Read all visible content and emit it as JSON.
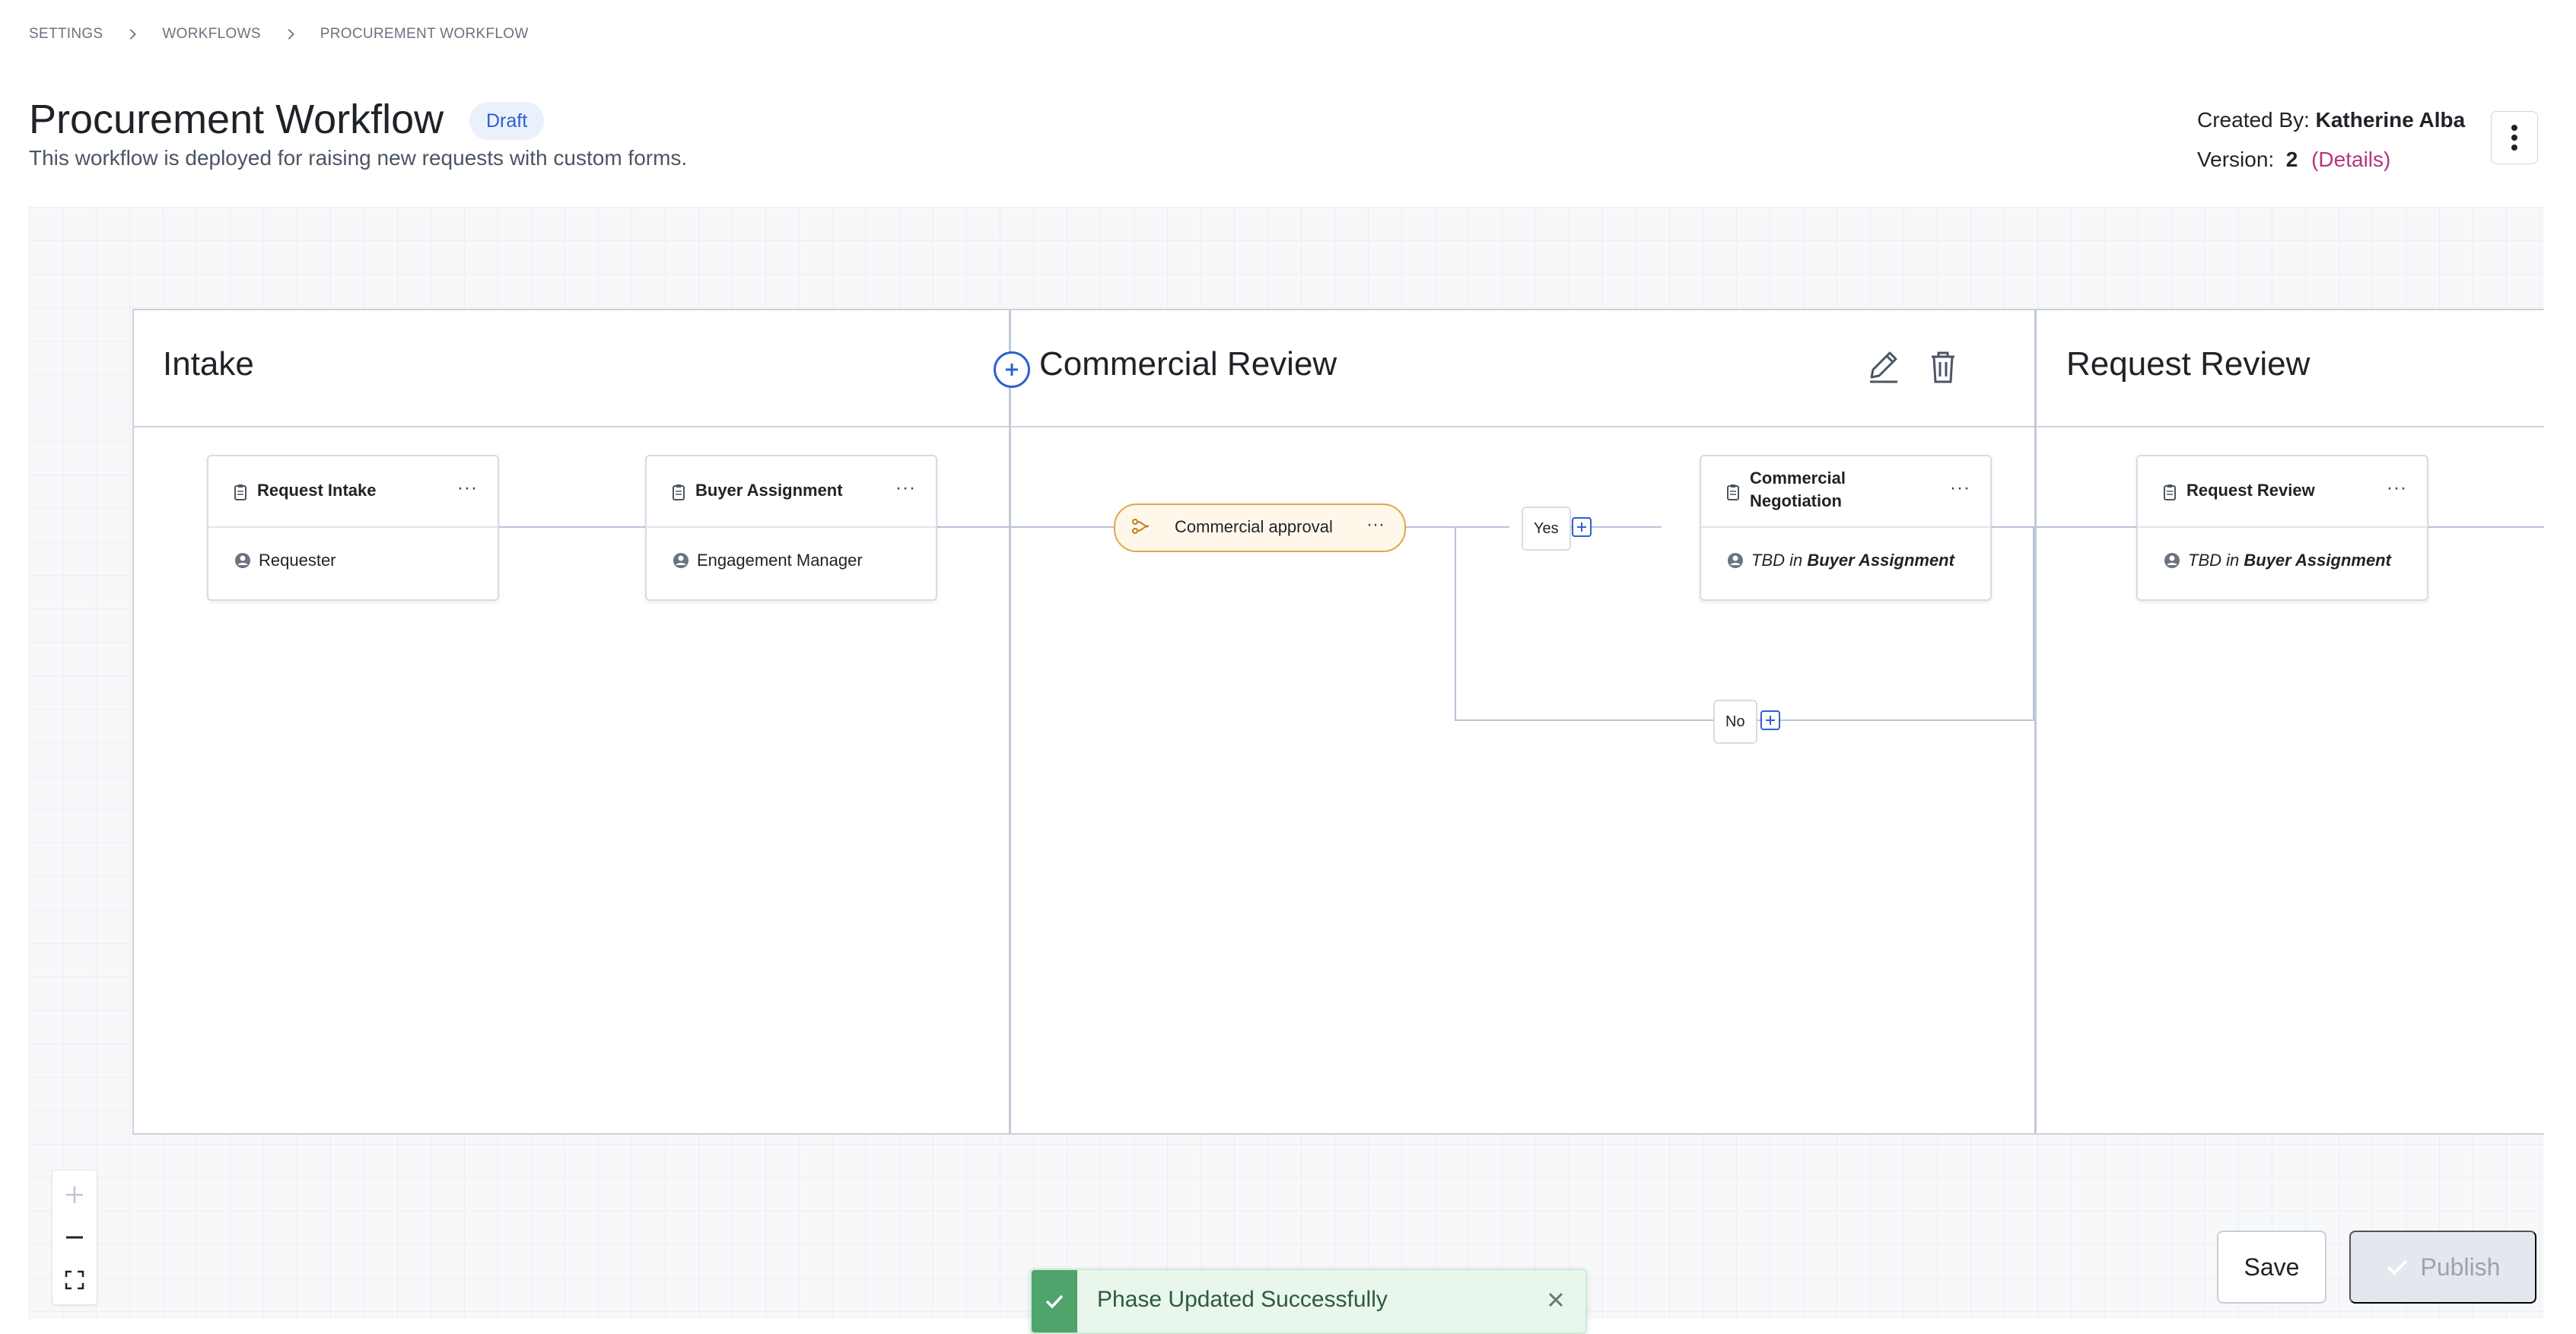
{
  "breadcrumb": [
    "SETTINGS",
    "WORKFLOWS",
    "PROCUREMENT WORKFLOW"
  ],
  "header": {
    "title": "Procurement Workflow",
    "status": "Draft",
    "description": "This workflow is deployed for raising new requests with custom forms.",
    "created_by_label": "Created By:",
    "created_by": "Katherine Alba",
    "version_label": "Version:",
    "version": "2",
    "details_link": "(Details)"
  },
  "phases": [
    {
      "title": "Intake"
    },
    {
      "title": "Commercial Review"
    },
    {
      "title": "Request Review"
    }
  ],
  "steps": {
    "request_intake": {
      "title": "Request Intake",
      "assignee": "Requester"
    },
    "buyer_assignment": {
      "title": "Buyer Assignment",
      "assignee": "Engagement Manager"
    },
    "commercial_negotiation": {
      "title_line1": "Commercial",
      "title_line2": "Negotiation",
      "assignee_prefix": "TBD",
      "assignee_in": "in",
      "assignee_ref": "Buyer Assignment"
    },
    "request_review": {
      "title": "Request Review",
      "assignee_prefix": "TBD",
      "assignee_in": "in",
      "assignee_ref": "Buyer Assignment"
    }
  },
  "decision": {
    "label": "Commercial approval"
  },
  "branches": {
    "yes": "Yes",
    "no": "No"
  },
  "menu_glyph": "···",
  "actions": {
    "save": "Save",
    "publish": "Publish"
  },
  "toast": {
    "message": "Phase Updated Successfully"
  },
  "colors": {
    "accent": "#2f5fd0",
    "link": "#b83280",
    "decision_border": "#e1a649",
    "success": "#4ea46a"
  }
}
